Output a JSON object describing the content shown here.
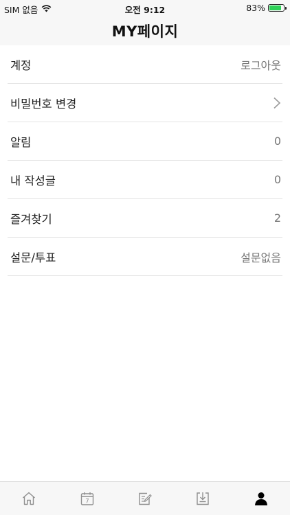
{
  "status_bar": {
    "carrier": "SIM 없음",
    "time": "오전 9:12",
    "battery_percent": "83%",
    "battery_level": 0.83,
    "battery_color": "#2fd158"
  },
  "nav": {
    "title": "MY페이지"
  },
  "menu": {
    "items": [
      {
        "label": "계정",
        "value": "로그아웃"
      },
      {
        "label": "비밀번호 변경",
        "value": "",
        "icon": "chevron-right-icon"
      },
      {
        "label": "알림",
        "value": "0"
      },
      {
        "label": "내 작성글",
        "value": "0"
      },
      {
        "label": "즐겨찾기",
        "value": "2"
      },
      {
        "label": "설문/투표",
        "value": "설문없음"
      }
    ]
  },
  "tab_bar": {
    "tabs": [
      {
        "icon": "home-icon",
        "active": false
      },
      {
        "icon": "calendar-icon",
        "calendar_day": "7",
        "active": false
      },
      {
        "icon": "write-icon",
        "active": false
      },
      {
        "icon": "download-icon",
        "active": false
      },
      {
        "icon": "person-icon",
        "active": true
      }
    ],
    "active_color": "#000000",
    "inactive_color": "#8e8e8e"
  }
}
